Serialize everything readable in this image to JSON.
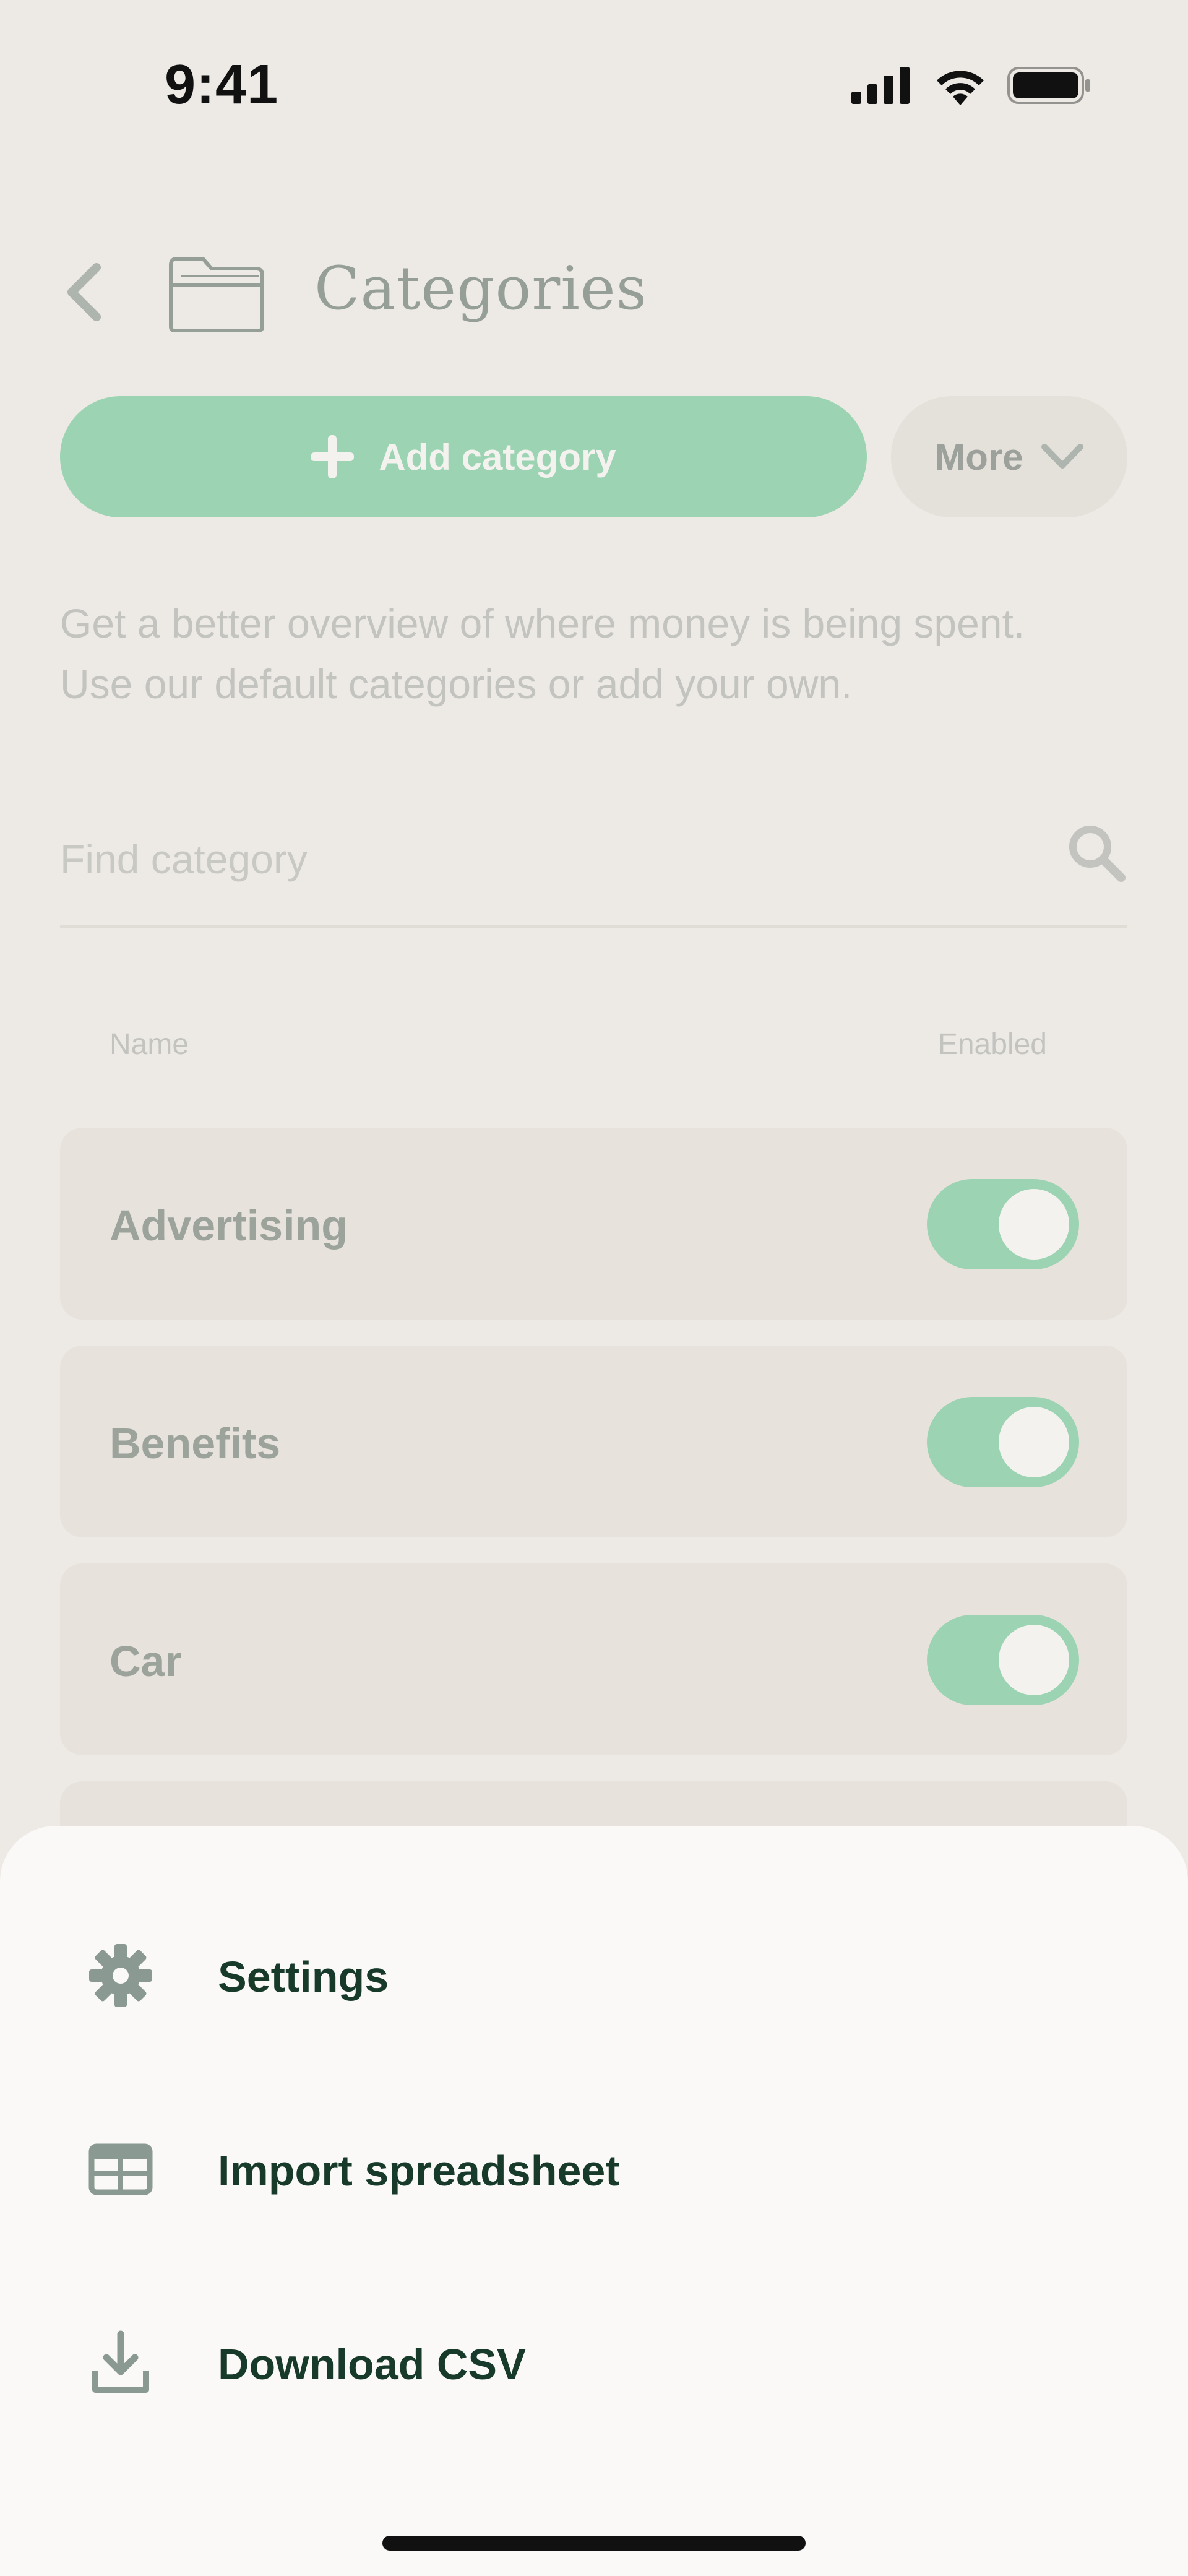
{
  "status_bar": {
    "time": "9:41",
    "icons": [
      "cellular-signal-icon",
      "wifi-icon",
      "battery-icon"
    ]
  },
  "header": {
    "back_icon": "chevron-left-icon",
    "title_icon": "folder-icon",
    "title": "Categories"
  },
  "actions": {
    "add_label": "Add category",
    "more_label": "More"
  },
  "description": {
    "line1": "Get a better overview of where money is being spent.",
    "line2": "Use our default categories or add your own."
  },
  "search": {
    "placeholder": "Find category",
    "value": ""
  },
  "table": {
    "columns": [
      "Name",
      "Enabled"
    ],
    "rows": [
      {
        "name": "Advertising",
        "enabled": true
      },
      {
        "name": "Benefits",
        "enabled": true
      },
      {
        "name": "Car",
        "enabled": true
      }
    ]
  },
  "sheet": {
    "items": [
      {
        "label": "Settings",
        "icon": "gear-icon"
      },
      {
        "label": "Import spreadsheet",
        "icon": "table-icon"
      },
      {
        "label": "Download CSV",
        "icon": "download-icon"
      }
    ]
  },
  "colors": {
    "background": "#EDEAE5",
    "accent": "#2DB56E",
    "sheet": "#FAF9F7",
    "text_dark": "#173A2A"
  }
}
